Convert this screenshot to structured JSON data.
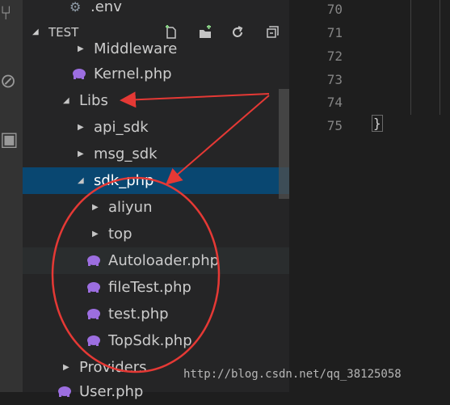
{
  "explorer": {
    "above_item": {
      "name": ".env",
      "icon": "gear-icon"
    },
    "section_title": "TEST",
    "header_actions": [
      "new-file-icon",
      "new-folder-icon",
      "refresh-icon",
      "collapse-all-icon"
    ],
    "tree": [
      {
        "label": "Middleware",
        "kind": "folder",
        "state": "collapsed"
      },
      {
        "label": "Kernel.php",
        "kind": "php-file"
      },
      {
        "label": "Libs",
        "kind": "folder",
        "state": "expanded"
      },
      {
        "label": "api_sdk",
        "kind": "folder",
        "state": "collapsed"
      },
      {
        "label": "msg_sdk",
        "kind": "folder",
        "state": "collapsed"
      },
      {
        "label": "sdk_php",
        "kind": "folder",
        "state": "expanded",
        "selected": true
      },
      {
        "label": "aliyun",
        "kind": "folder",
        "state": "collapsed"
      },
      {
        "label": "top",
        "kind": "folder",
        "state": "collapsed"
      },
      {
        "label": "Autoloader.php",
        "kind": "php-file",
        "hover": true
      },
      {
        "label": "fileTest.php",
        "kind": "php-file"
      },
      {
        "label": "test.php",
        "kind": "php-file"
      },
      {
        "label": "TopSdk.php",
        "kind": "php-file"
      },
      {
        "label": "Providers",
        "kind": "folder",
        "state": "collapsed"
      },
      {
        "label": "User.php",
        "kind": "php-file"
      }
    ]
  },
  "editor": {
    "line_numbers": [
      "70",
      "71",
      "72",
      "73",
      "74",
      "75"
    ],
    "last_line_code": "}"
  },
  "watermark": "http://blog.csdn.net/qq_38125058",
  "colors": {
    "sidebar": "#252526",
    "selection": "#094771",
    "annotation": "#e53935",
    "php_icon": "#9c6ee0"
  }
}
